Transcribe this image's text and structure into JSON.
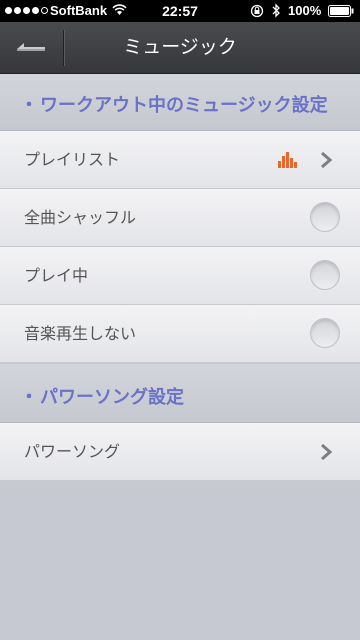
{
  "status_bar": {
    "carrier": "SoftBank",
    "time": "22:57",
    "battery": "100%"
  },
  "nav": {
    "title": "ミュージック",
    "back_icon": "back-arrow-icon"
  },
  "sections": [
    {
      "bullet": "・",
      "title": "ワークアウト中のミュージック設定"
    },
    {
      "bullet": "・",
      "title": "パワーソング設定"
    }
  ],
  "rows": {
    "playlist": "プレイリスト",
    "shuffle_all": "全曲シャッフル",
    "now_playing": "プレイ中",
    "no_music": "音楽再生しない",
    "power_song": "パワーソング"
  },
  "colors": {
    "accent": "#6a72c8",
    "equalizer": "#e8672a"
  }
}
